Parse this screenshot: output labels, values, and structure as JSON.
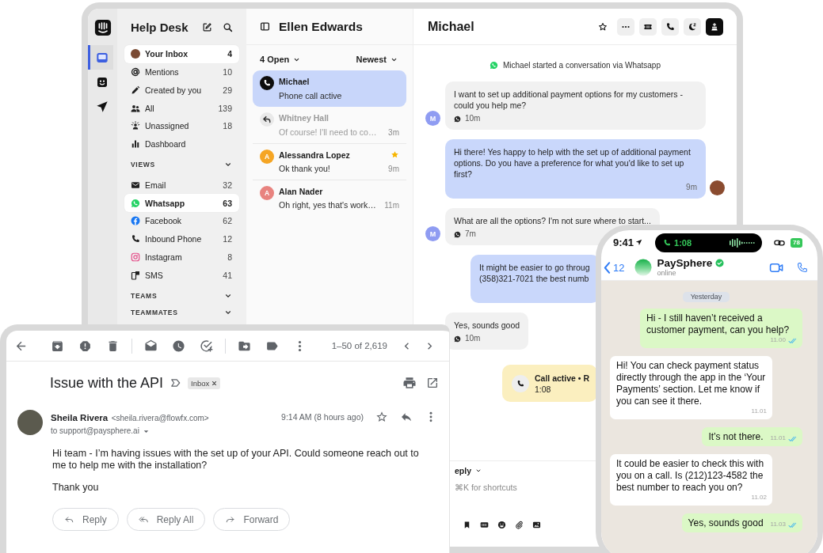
{
  "helpdesk": {
    "rail": [
      {
        "selected": true
      },
      {
        "selected": false
      },
      {
        "selected": false
      }
    ],
    "sidebar": {
      "title": "Help Desk",
      "items": [
        {
          "label": "Your Inbox",
          "count": "4",
          "selected": true
        },
        {
          "label": "Mentions",
          "count": "10",
          "selected": false
        },
        {
          "label": "Created by you",
          "count": "29",
          "selected": false
        },
        {
          "label": "All",
          "count": "139",
          "selected": false
        },
        {
          "label": "Unassigned",
          "count": "18",
          "selected": false
        },
        {
          "label": "Dashboard",
          "selected": false
        }
      ],
      "sections": [
        {
          "heading": "VIEWS",
          "items": [
            {
              "label": "Email",
              "count": "32",
              "selected": false
            },
            {
              "label": "Whatsapp",
              "count": "63",
              "selected": true
            },
            {
              "label": "Facebook",
              "count": "62",
              "selected": false
            },
            {
              "label": "Inbound Phone",
              "count": "12",
              "selected": false
            },
            {
              "label": "Instagram",
              "count": "8",
              "selected": false
            },
            {
              "label": "SMS",
              "count": "41",
              "selected": false
            }
          ]
        },
        {
          "heading": "TEAMS"
        },
        {
          "heading": "TEAMMATES"
        }
      ]
    },
    "inbox": {
      "title": "Ellen Edwards",
      "filter": "4 Open",
      "sort": "Newest",
      "conversations": [
        {
          "kind": "call",
          "name": "Michael",
          "preview": "Phone call active",
          "selected": true,
          "starred": false,
          "muted": false
        },
        {
          "kind": "replied",
          "name": "Whitney Hall",
          "preview": "Of course! I'll need to co…",
          "time": "3m",
          "selected": false,
          "starred": false,
          "muted": true
        },
        {
          "kind": "avatar",
          "initial": "A",
          "color": "#f5a524",
          "name": "Alessandra Lopez",
          "preview": "Ok thank you!",
          "time": "9m",
          "selected": false,
          "starred": true,
          "muted": false
        },
        {
          "kind": "avatar",
          "initial": "A",
          "color": "#e8837f",
          "name": "Alan Nader",
          "preview": "Oh right, yes that's work…",
          "time": "11m",
          "selected": false,
          "starred": false,
          "muted": false
        }
      ]
    },
    "conversation": {
      "title": "Michael",
      "messages": [
        {
          "kind": "system",
          "text": "Michael started a conversation via Whatsapp"
        },
        {
          "kind": "incoming",
          "initial": "M",
          "text": "I want to set up additional payment options for my customers - could you help me?",
          "time": "10m"
        },
        {
          "kind": "outgoing",
          "text": "Hi there! Yes happy to help with the set up of additional payment options. Do you have a preference for what you'd like to set up first?",
          "time": "9m"
        },
        {
          "kind": "incoming",
          "initial": "M",
          "text": "What are all the options? I'm not sure where to start...",
          "time": "7m"
        },
        {
          "kind": "outgoing",
          "text": "It might be easier to go throug\n(358)321-7021 the best numb"
        },
        {
          "kind": "incoming",
          "text": "Yes, sounds good",
          "time": "10m"
        },
        {
          "kind": "call",
          "title": "Call active • R",
          "duration": "1:08"
        }
      ],
      "composer": {
        "mode": "eply",
        "placeholder": "⌘K for shortcuts"
      }
    }
  },
  "email": {
    "pagination": "1–50 of 2,619",
    "subject": "Issue with the API",
    "label": "Inbox",
    "sender": "Sheila Rivera",
    "address": "<sheila.rivera@flowfx.com>",
    "recipient": "to support@paysphere.ai",
    "time": "9:14 AM (8 hours ago)",
    "body": [
      "Hi team - I’m having issues with the set up of your API. Could someone reach out to me to help me with the installation?",
      "Thank you"
    ],
    "actions": [
      "Reply",
      "Reply All",
      "Forward"
    ]
  },
  "phone": {
    "clock": "9:41",
    "call_timer": "1:08",
    "battery": "78",
    "back_count": "12",
    "contact": "PaySphere",
    "verified": true,
    "presence": "online",
    "date": "Yesterday",
    "messages": [
      {
        "kind": "sent",
        "text": "Hi - I still haven’t received a customer payment, can you help?",
        "time": "11.00",
        "read": true
      },
      {
        "kind": "received",
        "text": "Hi! You can check payment status directly through the app in the ‘Your Payments’ section. Let me know if you can see it there.",
        "time": "11.01",
        "read": false
      },
      {
        "kind": "sent",
        "text": "It’s not there.",
        "time": "11.01",
        "read": true
      },
      {
        "kind": "received",
        "text": "It could be easier to check this with you on a call. Is (212)123-4582 the best number to reach you on?",
        "time": "11.02",
        "read": false
      },
      {
        "kind": "sent",
        "text": "Yes, sounds good",
        "time": "11.03",
        "read": true
      }
    ]
  }
}
